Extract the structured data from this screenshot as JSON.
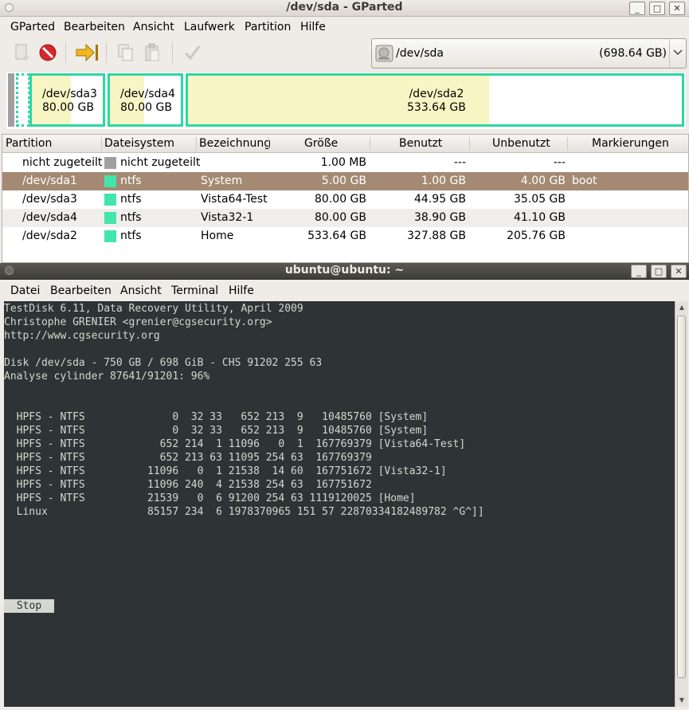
{
  "gparted": {
    "title": "/dev/sda - GParted",
    "menu": [
      "GParted",
      "Bearbeiten",
      "Ansicht",
      "Laufwerk",
      "Partition",
      "Hilfe"
    ],
    "device": {
      "name": "/dev/sda",
      "size": "(698.64 GB)"
    },
    "map": [
      {
        "name": "/dev/sda3",
        "size": "80.00 GB",
        "used_fraction": 0.55
      },
      {
        "name": "/dev/sda4",
        "size": "80.00 GB",
        "used_fraction": 0.48
      },
      {
        "name": "/dev/sda2",
        "size": "533.64 GB",
        "used_fraction": 0.61
      }
    ],
    "columns": [
      "Partition",
      "Dateisystem",
      "Bezeichnung",
      "Größe",
      "Benutzt",
      "Unbenutzt",
      "Markierungen"
    ],
    "rows": [
      {
        "partition": "nicht zugeteilt",
        "fs": "nicht zugeteilt",
        "fs_color": "#a0a0a0",
        "label": "",
        "size": "1.00 MB",
        "used": "---",
        "unused": "---",
        "flags": ""
      },
      {
        "partition": "/dev/sda1",
        "fs": "ntfs",
        "fs_color": "#42e5ac",
        "label": "System",
        "size": "5.00 GB",
        "used": "1.00 GB",
        "unused": "4.00 GB",
        "flags": "boot"
      },
      {
        "partition": "/dev/sda3",
        "fs": "ntfs",
        "fs_color": "#42e5ac",
        "label": "Vista64-Test",
        "size": "80.00 GB",
        "used": "44.95 GB",
        "unused": "35.05 GB",
        "flags": ""
      },
      {
        "partition": "/dev/sda4",
        "fs": "ntfs",
        "fs_color": "#42e5ac",
        "label": "Vista32-1",
        "size": "80.00 GB",
        "used": "38.90 GB",
        "unused": "41.10 GB",
        "flags": ""
      },
      {
        "partition": "/dev/sda2",
        "fs": "ntfs",
        "fs_color": "#42e5ac",
        "label": "Home",
        "size": "533.64 GB",
        "used": "327.88 GB",
        "unused": "205.76 GB",
        "flags": ""
      }
    ]
  },
  "terminal": {
    "title": "ubuntu@ubuntu: ~",
    "menu": [
      "Datei",
      "Bearbeiten",
      "Ansicht",
      "Terminal",
      "Hilfe"
    ],
    "lines": [
      "TestDisk 6.11, Data Recovery Utility, April 2009",
      "Christophe GRENIER <grenier@cgsecurity.org>",
      "http://www.cgsecurity.org",
      "",
      "Disk /dev/sda - 750 GB / 698 GiB - CHS 91202 255 63",
      "Analyse cylinder 87641/91201: 96%",
      "",
      "",
      "  HPFS - NTFS              0  32 33   652 213  9   10485760 [System]",
      "  HPFS - NTFS              0  32 33   652 213  9   10485760 [System]",
      "  HPFS - NTFS            652 214  1 11096   0  1  167769379 [Vista64-Test]",
      "  HPFS - NTFS            652 213 63 11095 254 63  167769379",
      "  HPFS - NTFS          11096   0  1 21538  14 60  167751672 [Vista32-1]",
      "  HPFS - NTFS          11096 240  4 21538 254 63  167751672",
      "  HPFS - NTFS          21539   0  6 91200 254 63 1119120025 [Home]",
      "  Linux                85157 234  6 1978370965 151 57 22870334182489782 ^G^]]"
    ],
    "stop_label": "Stop"
  },
  "colors": {
    "ntfs": "#42e5ac",
    "unallocated": "#a0a0a0",
    "partition_border": "#2bd7a3",
    "used_fill": "#f8f5c4",
    "selection": "#a48a72",
    "terminal_bg": "#2e3436"
  }
}
